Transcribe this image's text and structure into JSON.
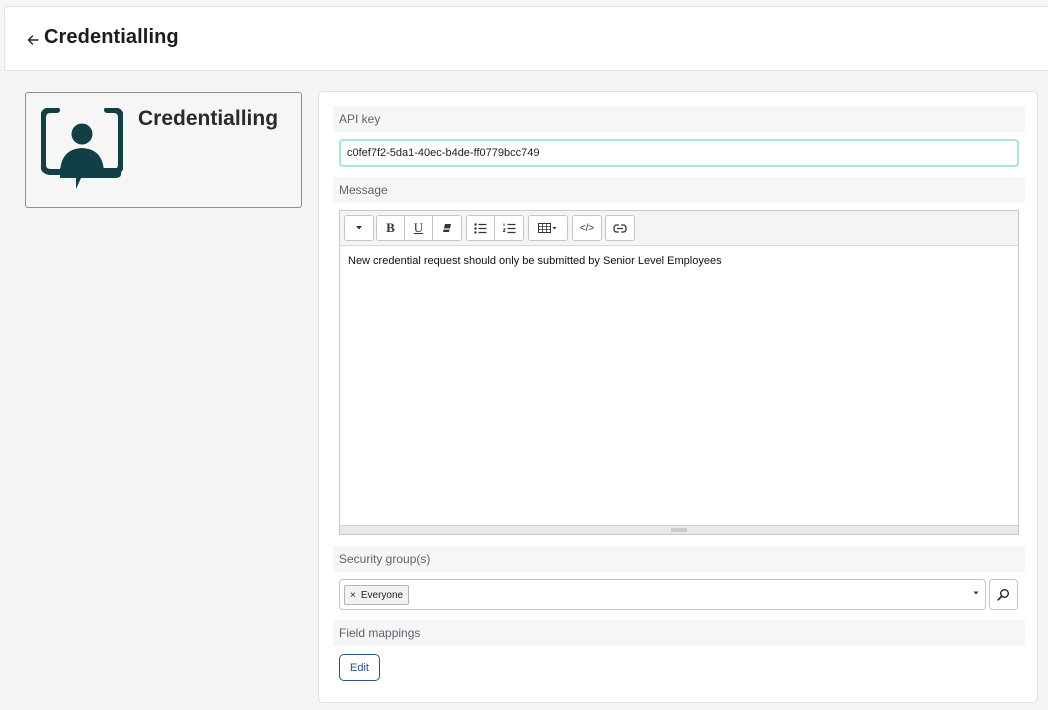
{
  "header": {
    "back_icon": "arrow-left-icon",
    "title": "Credentialling"
  },
  "app_card": {
    "logo_icon": "person-presentation-icon",
    "name": "Credentialling",
    "brand_color": "#123f45"
  },
  "form": {
    "api_key": {
      "label": "API key",
      "value": "c0fef7f2-5da1-40ec-b4de-ff0779bcc749"
    },
    "message": {
      "label": "Message",
      "toolbar": {
        "style_dropdown_icon": "caret-down-icon",
        "bold_label": "B",
        "underline_label": "U",
        "clear_format_icon": "eraser-icon",
        "bullet_list_icon": "bullet-list-icon",
        "numbered_list_icon": "numbered-list-icon",
        "table_icon": "table-icon",
        "code_view_label": "</>",
        "link_icon": "link-icon"
      },
      "body": "New credential request should only be submitted by Senior Level Employees"
    },
    "security_groups": {
      "label": "Security group(s)",
      "selected": [
        {
          "remove_label": "×",
          "label": "Everyone"
        }
      ],
      "dropdown_icon": "caret-down-icon",
      "lookup_icon": "search-icon"
    },
    "field_mappings": {
      "label": "Field mappings",
      "edit_label": "Edit"
    }
  }
}
